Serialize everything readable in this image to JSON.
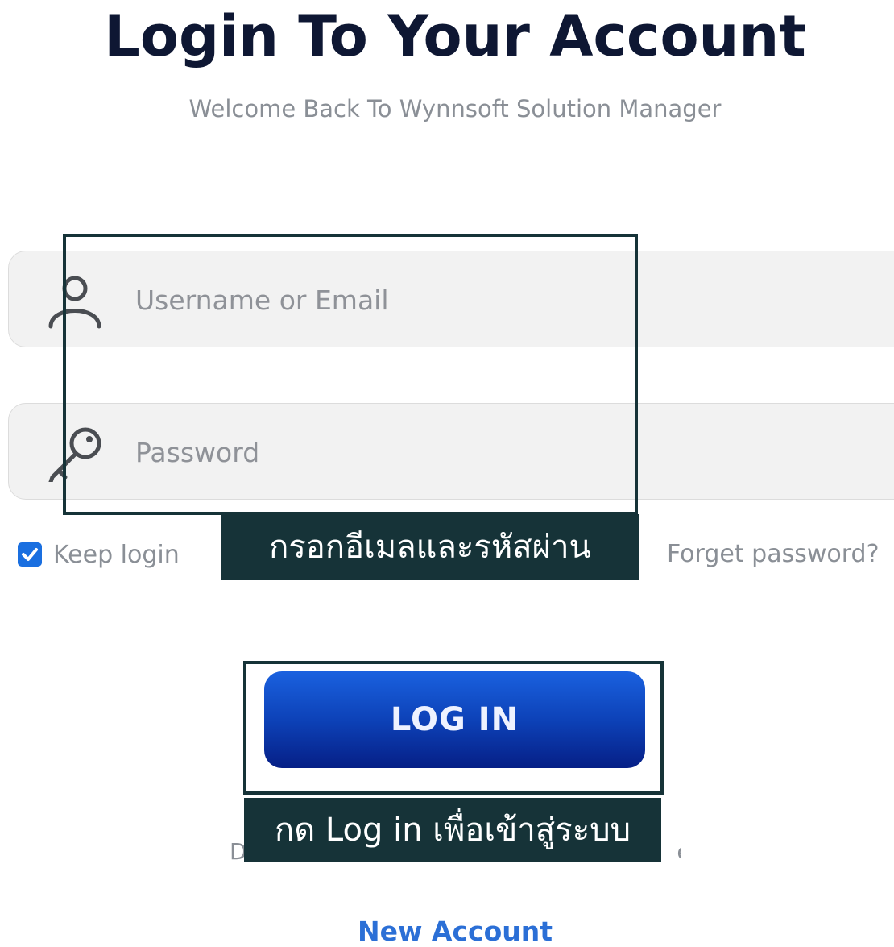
{
  "header": {
    "title": "Login To Your Account",
    "subtitle": "Welcome Back To Wynnsoft Solution Manager"
  },
  "form": {
    "username": {
      "placeholder": "Username or Email",
      "value": "",
      "icon": "user-icon"
    },
    "password": {
      "placeholder": "Password",
      "value": "",
      "icon": "key-icon"
    },
    "keep_login": {
      "label": "Keep login",
      "checked": true
    },
    "forget_password_label": "Forget password?",
    "login_button_label": "LOG IN",
    "signup_prompt_visible_start": "D",
    "signup_prompt_visible_end": "e",
    "new_account_label": "New Account"
  },
  "annotations": {
    "credentials_caption": "กรอกอีเมลและรหัสผ่าน",
    "login_caption": "กด Log in เพื่อเข้าสู่ระบบ"
  },
  "colors": {
    "title": "#0e1733",
    "muted_text": "#8a8f96",
    "input_background": "#f2f2f2",
    "annotation_dark": "#163338",
    "button_gradient_top": "#1a61df",
    "button_gradient_bottom": "#061f86",
    "link_blue": "#2b6fd6",
    "checkbox_blue": "#1a6fe0"
  }
}
